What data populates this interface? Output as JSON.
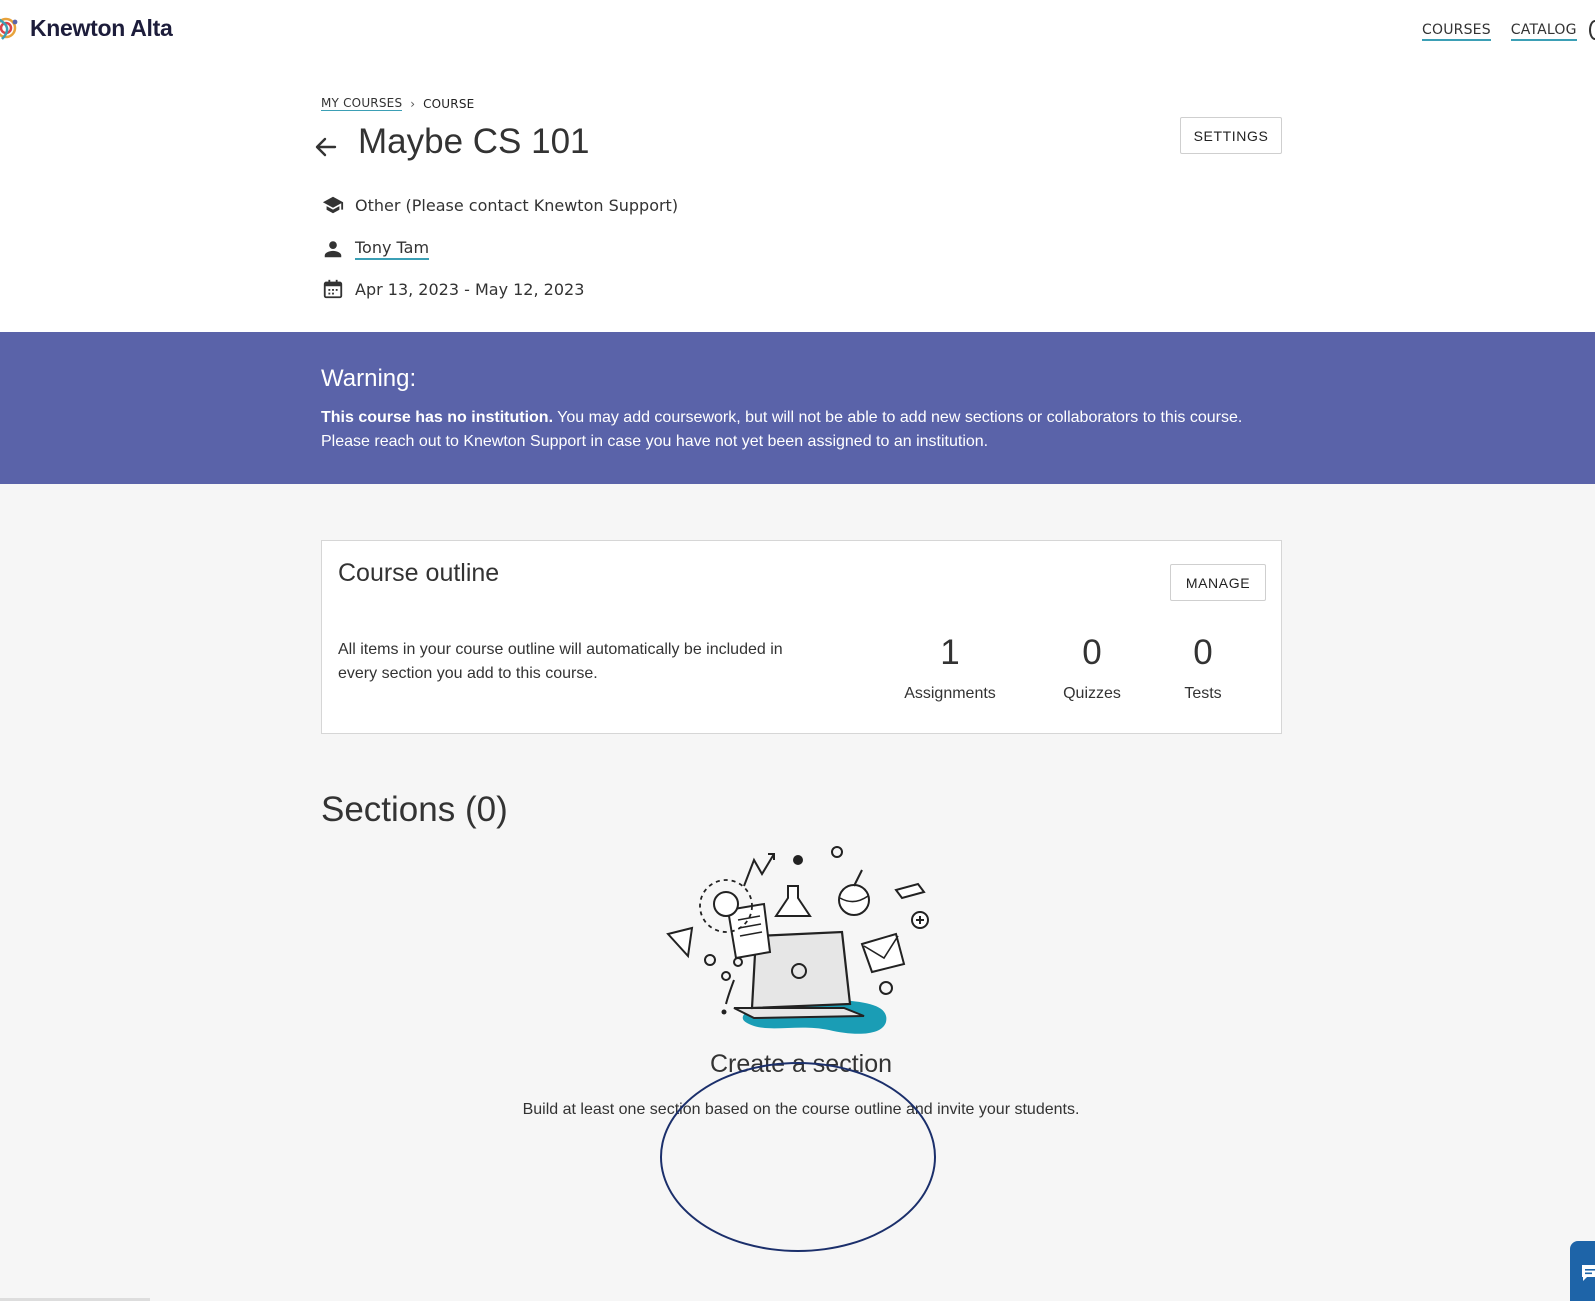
{
  "app": {
    "name": "Knewton Alta"
  },
  "nav": {
    "courses": "COURSES",
    "catalog": "CATALOG"
  },
  "breadcrumb": {
    "my_courses": "MY COURSES",
    "separator": "›",
    "current": "COURSE"
  },
  "course": {
    "title": "Maybe CS 101",
    "settings_label": "SETTINGS",
    "institution": "Other (Please contact Knewton Support)",
    "instructor": "Tony Tam",
    "dates": "Apr 13, 2023 - May 12, 2023"
  },
  "warning": {
    "title": "Warning:",
    "bold": "This course has no institution.",
    "line1": " You may add coursework, but will not be able to add new sections or collaborators to this course.",
    "line2": "Please reach out to Knewton Support in case you have not yet been assigned to an institution.",
    "bg_color": "#5a63a9"
  },
  "outline": {
    "title": "Course outline",
    "manage_label": "MANAGE",
    "description": "All items in your course outline will automatically be included in every section you add to this course.",
    "stats": [
      {
        "value": "1",
        "label": "Assignments"
      },
      {
        "value": "0",
        "label": "Quizzes"
      },
      {
        "value": "0",
        "label": "Tests"
      }
    ]
  },
  "sections": {
    "title": "Sections (0)",
    "create_title": "Create a section",
    "create_desc": "Build at least one section based on the course outline and invite your students."
  },
  "colors": {
    "accent_underline": "#3b9fb5",
    "chat": "#1e64a8",
    "illustration_accent": "#1a9db5"
  }
}
